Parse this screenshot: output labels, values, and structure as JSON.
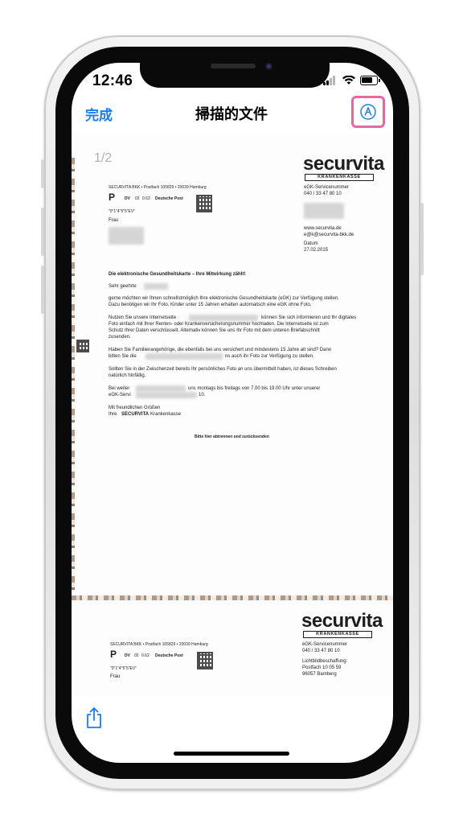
{
  "status": {
    "time": "12:46"
  },
  "nav": {
    "done_label": "完成",
    "title": "掃描的文件"
  },
  "document": {
    "page_indicator": "1/2",
    "page1": {
      "logo": "securvita",
      "logo_sub": "KRANKENKASSE",
      "sender_line": "SECURVITA BKK • Postfach 105829 • 20039 Hamburg",
      "postage": {
        "p": "P",
        "dv": "DV",
        "code1": "02",
        "code2": "0.62",
        "dp": "Deutsche Post"
      },
      "barcode_code": "\"0\"1\"4\"5\"5\"EV\"",
      "recipient_salutation": "Frau",
      "service_label": "eGK-Servicenummer",
      "service_number": "040 / 33 47 80 10",
      "web": "www.securvita.de",
      "email": "e@k@securvita-bkk.de",
      "date_label": "Datum",
      "date": "27.02.2015",
      "subject": "Die elektronische Gesundheitskarte – Ihre Mitwirkung zählt!",
      "greeting": "Sehr geehrte",
      "p1": [
        "gerne möchten wir Ihnen schnellstmöglich Ihre elektronische Gesundheitskarte (eGK) zur Verfügung stellen.",
        "Dazu benötigen wir Ihr Foto. Kinder unter 15 Jahren erhalten automatisch eine eGK ohne Foto."
      ],
      "p2": [
        "Nutzen Sie unsere Internetseite",
        "können Sie sich informieren und Ihr digitales",
        "Foto einfach mit Ihrer Renten- oder Krankenversicherungsnummer hochladen. Die Internetseite ist zum",
        "Schutz Ihrer Daten verschlüsselt. Alternativ können Sie uns Ihr Foto mit dem unteren Briefabschnitt",
        "zusenden."
      ],
      "p3": [
        "Haben Sie Familienangehörige, die ebenfalls bei uns versichert und mindestens 15 Jahre alt sind? Dann",
        "bitten Sie die",
        "ns auch ihr Foto zur Verfügung zu stellen."
      ],
      "p4": [
        "Sollten Sie in der Zwischenzeit bereits Ihr persönliches Foto an uns übermittelt haben, ist dieses Schreiben",
        "natürlich hinfällig."
      ],
      "p5": [
        "Bei weiter",
        "uns montags bis freitags von 7.00 bis 19.00 Uhr unter unserer",
        "eGK-Servi",
        "10."
      ],
      "closing": "Mit freundlichen Grüßen",
      "signature_prefix": "Ihre",
      "signature_bold": "SECURVITA",
      "signature_suffix": "Krankenkasse",
      "cut_line": "Bitte hier abtrennen und zurücksenden"
    },
    "page2": {
      "logo": "securvita",
      "logo_sub": "KRANKENKASSE",
      "sender_line": "SECURVITA BKK • Postfach 105829 • 20039 Hamburg",
      "postage": {
        "p": "P",
        "dv": "DV",
        "code1": "02",
        "code2": "0.62",
        "dp": "Deutsche Post"
      },
      "barcode_code": "\"0\"1\"4\"5\"5\"EV\"",
      "recipient_salutation": "Frau",
      "service_label": "eGK-Servicenummer",
      "service_number": "040 / 33 47 80 10",
      "photo_label": "Lichtbildbeschaffung:",
      "postbox": "Postfach 10 05 59",
      "city": "96057 Bamberg"
    }
  },
  "colors": {
    "accent": "#1a7cf5",
    "highlight": "#e8679f"
  },
  "icons": [
    "markup-pen-icon",
    "share-icon",
    "wifi-icon",
    "signal-icon",
    "battery-icon"
  ]
}
